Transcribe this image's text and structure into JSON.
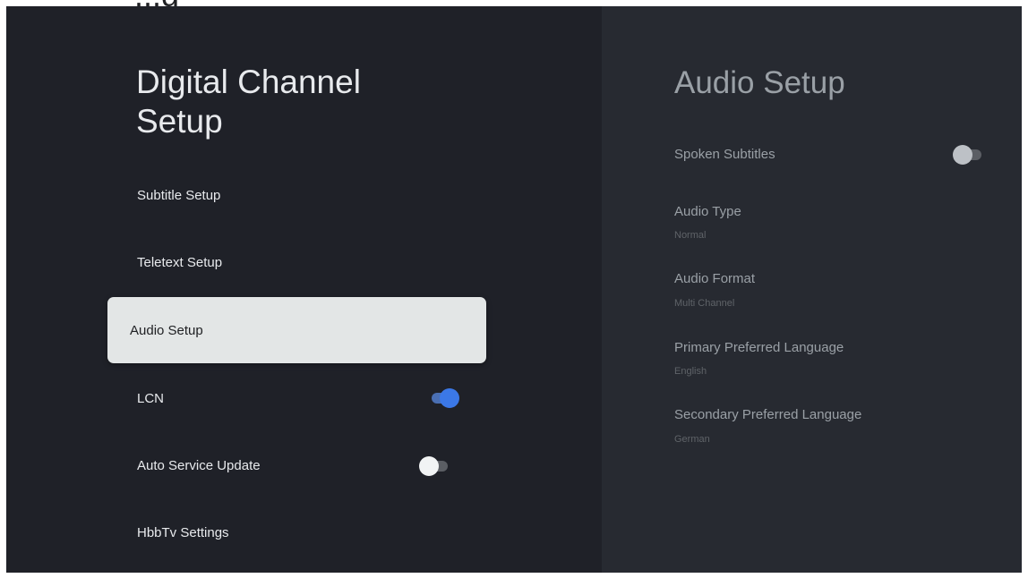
{
  "page_fragment_title": "...g",
  "left_panel": {
    "title": "Digital Channel Setup",
    "items": [
      {
        "label": "Subtitle Setup"
      },
      {
        "label": "Teletext Setup"
      },
      {
        "label": "Audio Setup",
        "selected": true
      },
      {
        "label": "LCN",
        "toggle": "on"
      },
      {
        "label": "Auto Service Update",
        "toggle": "off"
      },
      {
        "label": "HbbTv Settings"
      }
    ]
  },
  "right_panel": {
    "title": "Audio Setup",
    "items": [
      {
        "label": "Spoken Subtitles",
        "toggle": "off"
      },
      {
        "label": "Audio Type",
        "value": "Normal"
      },
      {
        "label": "Audio Format",
        "value": "Multi Channel"
      },
      {
        "label": "Primary Preferred Language",
        "value": "English"
      },
      {
        "label": "Secondary Preferred Language",
        "value": "German"
      }
    ]
  },
  "colors": {
    "background": "#1f2128",
    "right_pane": "#272a31",
    "selected_item": "#e3e6e6",
    "toggle_on": "#3b78e7"
  }
}
